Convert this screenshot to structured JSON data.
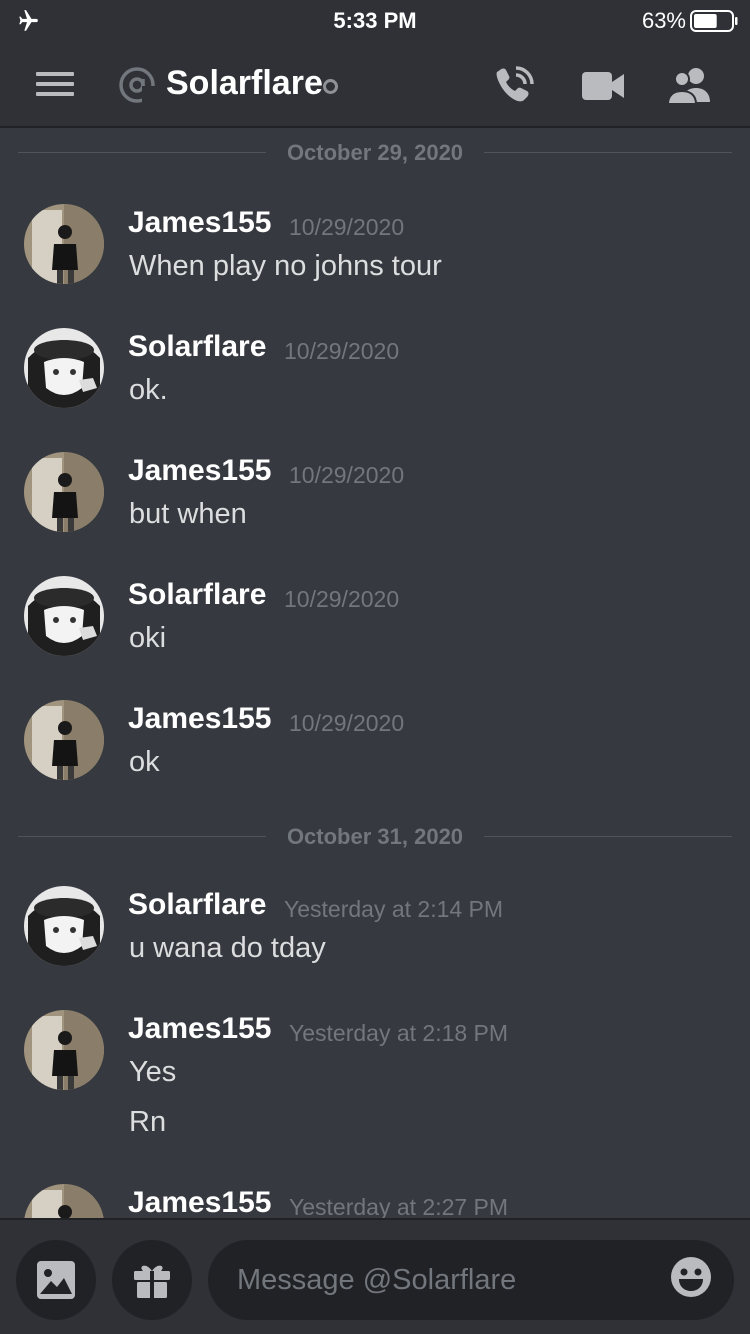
{
  "status_bar": {
    "time": "5:33 PM",
    "battery_percent_label": "63%",
    "battery_level": 0.63
  },
  "header": {
    "channel_name": "Solarflare",
    "icons": [
      "hamburger-icon",
      "at-icon",
      "call-icon",
      "video-icon",
      "members-icon"
    ]
  },
  "messages": {
    "dividers": [
      {
        "label": "October 29, 2020"
      },
      {
        "label": "October 31, 2020"
      }
    ],
    "items": [
      {
        "author": "James155",
        "timestamp": "10/29/2020",
        "lines": [
          "When play no johns tour"
        ]
      },
      {
        "author": "Solarflare",
        "timestamp": "10/29/2020",
        "lines": [
          "ok."
        ]
      },
      {
        "author": "James155",
        "timestamp": "10/29/2020",
        "lines": [
          "but when"
        ]
      },
      {
        "author": "Solarflare",
        "timestamp": "10/29/2020",
        "lines": [
          "oki"
        ]
      },
      {
        "author": "James155",
        "timestamp": "10/29/2020",
        "lines": [
          "ok"
        ]
      },
      {
        "author": "Solarflare",
        "timestamp": "Yesterday at 2:14 PM",
        "lines": [
          "u wana do tday"
        ]
      },
      {
        "author": "James155",
        "timestamp": "Yesterday at 2:18 PM",
        "lines": [
          "Yes",
          "Rn"
        ]
      },
      {
        "author": "James155",
        "timestamp": "Yesterday at 2:27 PM",
        "lines": []
      }
    ]
  },
  "composer": {
    "placeholder": "Message @Solarflare"
  },
  "colors": {
    "background": "#36393f",
    "header_background": "#2f3136",
    "input_background": "#202225",
    "muted_text": "#72767d",
    "username": "#ffffff"
  }
}
